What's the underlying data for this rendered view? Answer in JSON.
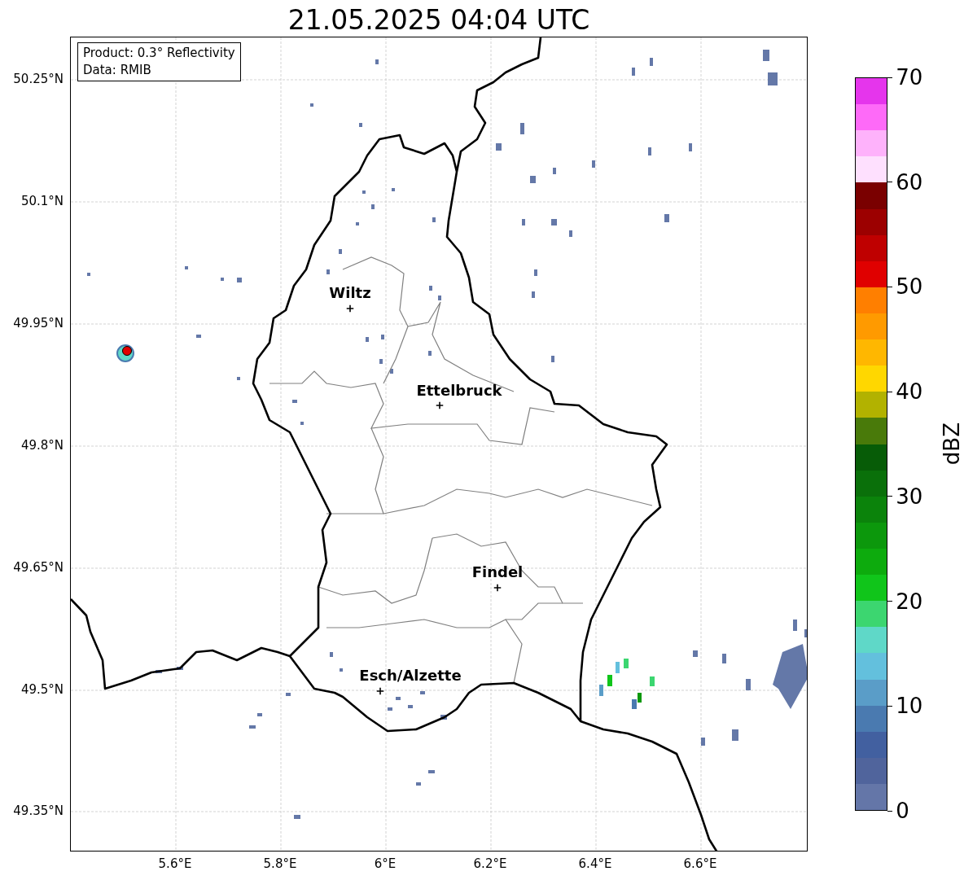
{
  "title": "21.05.2025 04:04 UTC",
  "info_box": [
    "Product: 0.3° Reflectivity",
    "Data: RMIB"
  ],
  "y_axis_labels": [
    "50.25°N",
    "50.1°N",
    "49.95°N",
    "49.8°N",
    "49.65°N",
    "49.5°N",
    "49.35°N"
  ],
  "x_axis_labels": [
    "5.6°E",
    "5.8°E",
    "6°E",
    "6.2°E",
    "6.4°E",
    "6.6°E"
  ],
  "cities": [
    {
      "name": "Wiltz"
    },
    {
      "name": "Ettelbruck"
    },
    {
      "name": "Findel"
    },
    {
      "name": "Esch/Alzette"
    }
  ],
  "colorbar": {
    "label": "dBZ",
    "ticks": [
      "70",
      "60",
      "50",
      "40",
      "30",
      "20",
      "10",
      "0"
    ],
    "bins": [
      {
        "color": "#e535ec"
      },
      {
        "color": "#fe6af8"
      },
      {
        "color": "#feb2fb"
      },
      {
        "color": "#fee0fe"
      },
      {
        "color": "#7a0000"
      },
      {
        "color": "#9c0000"
      },
      {
        "color": "#bf0000"
      },
      {
        "color": "#e00000"
      },
      {
        "color": "#ff7f00"
      },
      {
        "color": "#ff9a00"
      },
      {
        "color": "#ffb700"
      },
      {
        "color": "#ffd700"
      },
      {
        "color": "#b2b200"
      },
      {
        "color": "#497a0a"
      },
      {
        "color": "#075c07"
      },
      {
        "color": "#0a700a"
      },
      {
        "color": "#0b830b"
      },
      {
        "color": "#0c980c"
      },
      {
        "color": "#0dab0d"
      },
      {
        "color": "#10c51a"
      },
      {
        "color": "#3cd670"
      },
      {
        "color": "#5fd8c8"
      },
      {
        "color": "#63c0dd"
      },
      {
        "color": "#5a9dc8"
      },
      {
        "color": "#4a7ab0"
      },
      {
        "color": "#4260a0"
      },
      {
        "color": "#50649c"
      },
      {
        "color": "#6476a8"
      }
    ]
  }
}
